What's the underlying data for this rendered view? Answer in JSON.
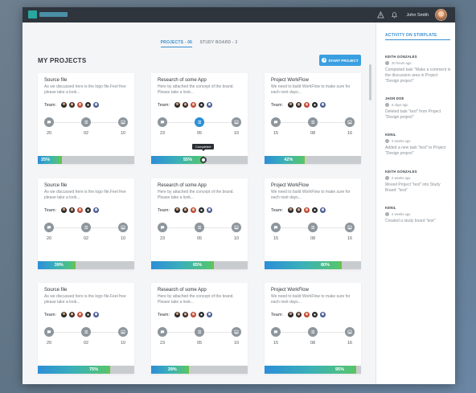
{
  "header": {
    "user_name": "John Smith"
  },
  "tabs": [
    {
      "label": "PROJECTS - 06"
    },
    {
      "label": "STUDY BOARD - 3"
    }
  ],
  "page_title": "MY PROJECTS",
  "start_button": "START PROJECT",
  "team_label": "Team:",
  "cards": [
    {
      "title": "Source file",
      "desc": "As we discussed here is the logo file.Feel free please take a look...",
      "counts": [
        "20",
        "02",
        "10"
      ],
      "progress": "25%",
      "progress_value": 25
    },
    {
      "title": "Research of some App",
      "desc": "Here by attached the concept of the brand. Please take a look...",
      "counts": [
        "23",
        "05",
        "10"
      ],
      "progress": "55%",
      "progress_value": 55,
      "tooltip": "Completed"
    },
    {
      "title": "Project WorkFlow",
      "desc": "We need to build WorkFlow to make sure for each next days...",
      "counts": [
        "15",
        "08",
        "16"
      ],
      "progress": "42%",
      "progress_value": 42
    },
    {
      "title": "Source file",
      "desc": "As we discussed here is the logo file.Feel free please take a look...",
      "counts": [
        "20",
        "02",
        "10"
      ],
      "progress": "39%",
      "progress_value": 39
    },
    {
      "title": "Research of some App",
      "desc": "Here by attached the concept of the brand. Please take a look...",
      "counts": [
        "23",
        "05",
        "10"
      ],
      "progress": "65%",
      "progress_value": 65
    },
    {
      "title": "Project WorkFlow",
      "desc": "We need to build WorkFlow to make sure for each next days...",
      "counts": [
        "15",
        "08",
        "16"
      ],
      "progress": "80%",
      "progress_value": 80
    },
    {
      "title": "Source file",
      "desc": "As we discussed here is the logo file.Feel free please take a look...",
      "counts": [
        "20",
        "02",
        "10"
      ],
      "progress": "75%",
      "progress_value": 75
    },
    {
      "title": "Research of some App",
      "desc": "Here by attached the concept of the brand. Please take a look...",
      "counts": [
        "23",
        "05",
        "10"
      ],
      "progress": "39%",
      "progress_value": 39
    },
    {
      "title": "Project WorkFlow",
      "desc": "We need to build WorkFlow to make sure for each next days...",
      "counts": [
        "15",
        "08",
        "16"
      ],
      "progress": "95%",
      "progress_value": 95
    }
  ],
  "sidebar": {
    "title": "ACTIVITY ON STIRPLATE",
    "items": [
      {
        "who": "KEITH GONZALES",
        "when": "20 hours ago",
        "what": "Completed task \"Make a comment in the discussion area in Project \"Design project\""
      },
      {
        "who": "JHON DOE",
        "when": "6 days ago",
        "what": "Deleted task \"test\" from Project \"Design project\""
      },
      {
        "who": "KENIL",
        "when": "2 weeks ago",
        "what": "Added a new task \"test\" to Project \"Design project\""
      },
      {
        "who": "KEITH GONZALES",
        "when": "2 weeks ago",
        "what": "Moved Project \"test\" into Study Board: \"test\""
      },
      {
        "who": "KENIL",
        "when": "2 weeks ago",
        "what": "Created a study board \"test\""
      }
    ]
  },
  "colors": {
    "accent": "#3a9fe0",
    "topbar": "#2f353d",
    "progress_start": "#2d8ed8",
    "progress_end": "#56c56d"
  },
  "icons": {
    "step1": "comment-icon",
    "step2": "list-icon",
    "step3": "image-icon"
  }
}
